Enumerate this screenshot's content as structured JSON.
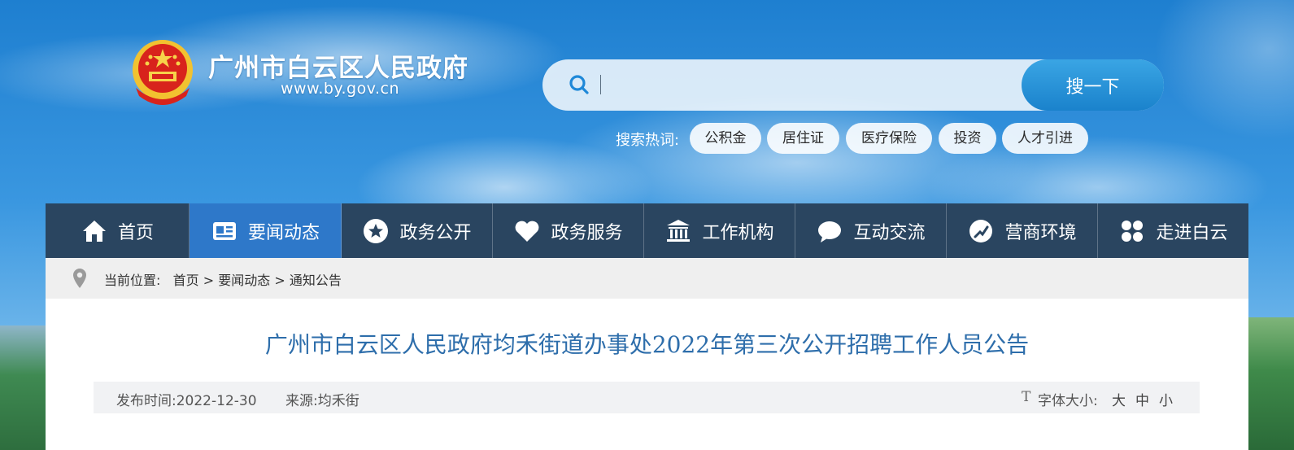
{
  "header": {
    "site_title": "广州市白云区人民政府",
    "site_domain": "www.by.gov.cn",
    "emblem_icon": "national-emblem-icon"
  },
  "search": {
    "placeholder": "",
    "button_label": "搜一下",
    "hot_label": "搜索热词:",
    "hot_words": [
      "公积金",
      "居住证",
      "医疗保险",
      "投资",
      "人才引进"
    ]
  },
  "nav": {
    "items": [
      {
        "label": "首页",
        "icon": "home-icon"
      },
      {
        "label": "要闻动态",
        "icon": "news-icon",
        "active": true
      },
      {
        "label": "政务公开",
        "icon": "star-icon"
      },
      {
        "label": "政务服务",
        "icon": "heart-icon"
      },
      {
        "label": "工作机构",
        "icon": "institution-icon"
      },
      {
        "label": "互动交流",
        "icon": "chat-icon"
      },
      {
        "label": "营商环境",
        "icon": "business-icon"
      },
      {
        "label": "走进白云",
        "icon": "grid-icon"
      }
    ]
  },
  "breadcrumb": {
    "label": "当前位置:",
    "items": [
      "首页",
      "要闻动态",
      "通知公告"
    ],
    "separator": ">"
  },
  "article": {
    "title": "广州市白云区人民政府均禾街道办事处2022年第三次公开招聘工作人员公告",
    "publish_label": "发布时间:",
    "publish_date": "2022-12-30",
    "source_label": "来源:",
    "source": "均禾街",
    "font_size_label": "字体大小:",
    "font_size_options": [
      "大",
      "中",
      "小"
    ]
  },
  "colors": {
    "nav_bg": "#2a4560",
    "nav_active": "#2e78c9",
    "title_blue": "#2e6eab",
    "search_button": "#1a82cc"
  }
}
